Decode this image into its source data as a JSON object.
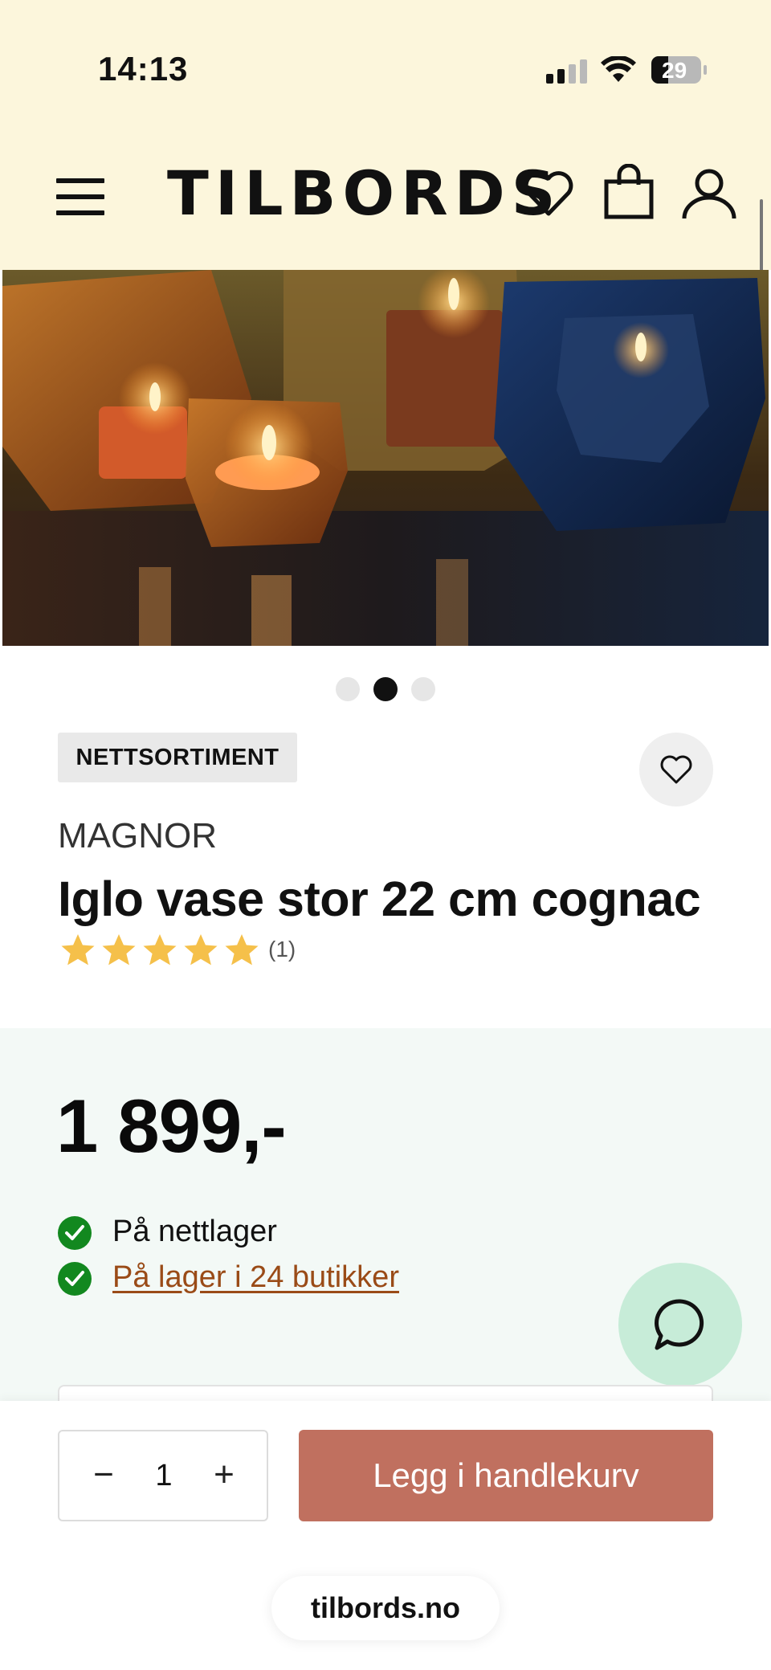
{
  "status_bar": {
    "time": "14:13",
    "battery": "29"
  },
  "header": {
    "logo": "TILBORDS",
    "icons": [
      "menu-icon",
      "heart-icon",
      "shopping-bag-icon",
      "user-icon"
    ]
  },
  "gallery": {
    "slide_count": 3,
    "active_slide": 2
  },
  "product": {
    "badge": "NETTSORTIMENT",
    "brand": "MAGNOR",
    "title": "Iglo vase stor 22 cm cognac",
    "rating": 5,
    "review_count": "(1)",
    "price": "1 899,-",
    "stock": [
      {
        "text": "På nettlager",
        "link": false
      },
      {
        "text": "På lager i 24 butikker",
        "link": true
      }
    ]
  },
  "cart_bar": {
    "minus": "−",
    "quantity": "1",
    "plus": "+",
    "add_to_cart_label": "Legg i handlekurv"
  },
  "browser": {
    "url": "tilbords.no"
  },
  "colors": {
    "header_bg": "#fcf6dc",
    "price_panel_bg": "#f3f9f6",
    "cta": "#c0705f",
    "check": "#12881f",
    "link": "#9a4b17",
    "star": "#f5c04a",
    "chat_bg": "#c7ecd8"
  }
}
